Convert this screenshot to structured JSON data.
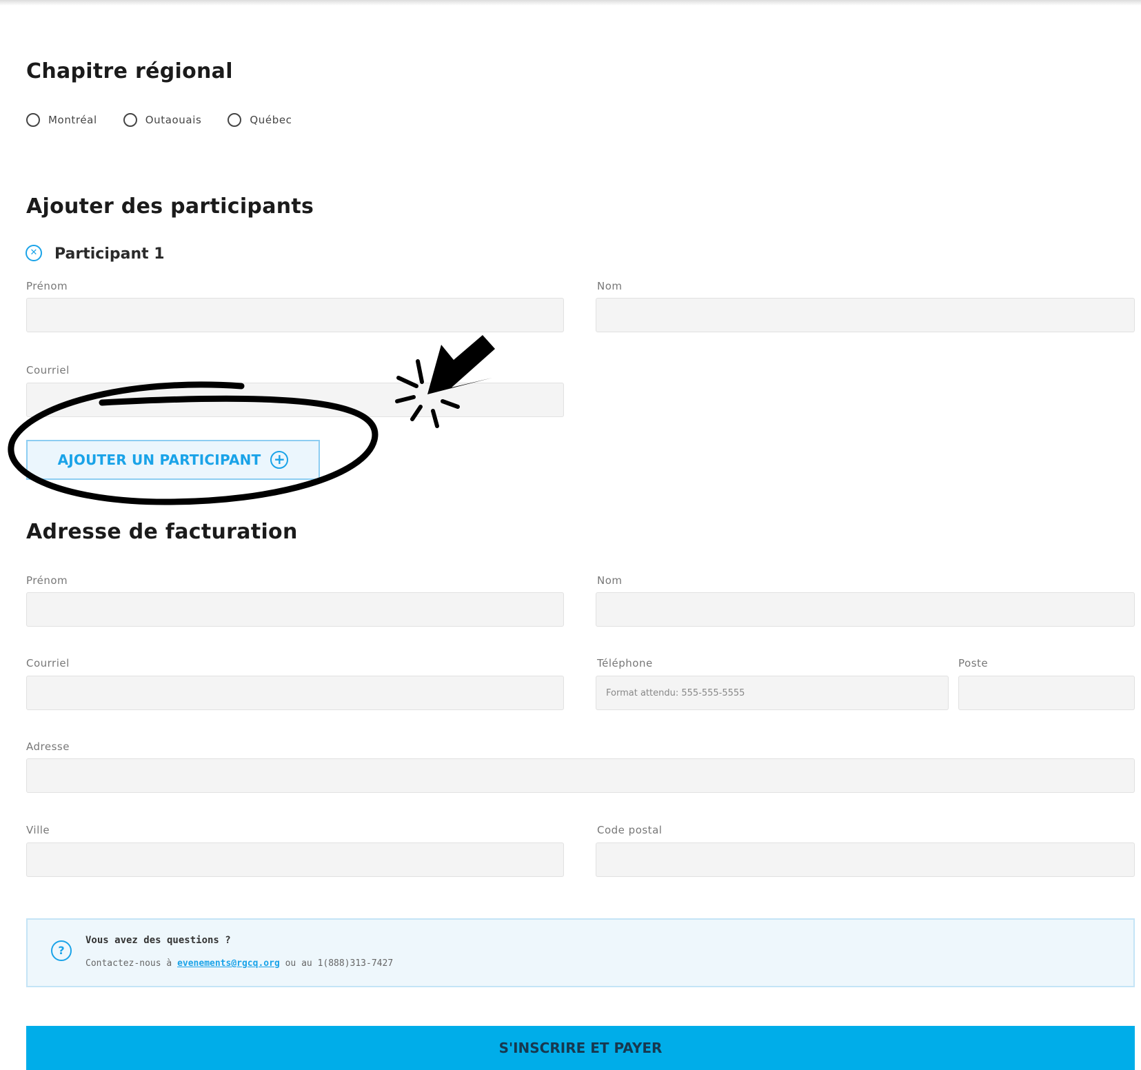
{
  "chapter": {
    "title": "Chapitre régional",
    "options": [
      "Montréal",
      "Outaouais",
      "Québec"
    ]
  },
  "participants": {
    "title": "Ajouter des participants",
    "participant_label": "Participant 1",
    "first_name_label": "Prénom",
    "last_name_label": "Nom",
    "email_label": "Courriel",
    "add_button_label": "AJOUTER UN PARTICIPANT"
  },
  "billing": {
    "title": "Adresse de facturation",
    "first_name_label": "Prénom",
    "last_name_label": "Nom",
    "email_label": "Courriel",
    "phone_label": "Téléphone",
    "phone_placeholder": "Format attendu: 555-555-5555",
    "extension_label": "Poste",
    "address_label": "Adresse",
    "city_label": "Ville",
    "postal_code_label": "Code postal"
  },
  "help": {
    "title": "Vous avez des questions ?",
    "prefix": "Contactez-nous à",
    "email": "evenements@rgcq.org",
    "suffix": "ou au 1(888)313-7427"
  },
  "submit_label": "S'INSCRIRE ET PAYER",
  "colors": {
    "accent": "#1aa3e8",
    "submit_bg": "#00ade9",
    "field_bg": "#f4f4f4",
    "info_bg": "#eef7fc"
  }
}
